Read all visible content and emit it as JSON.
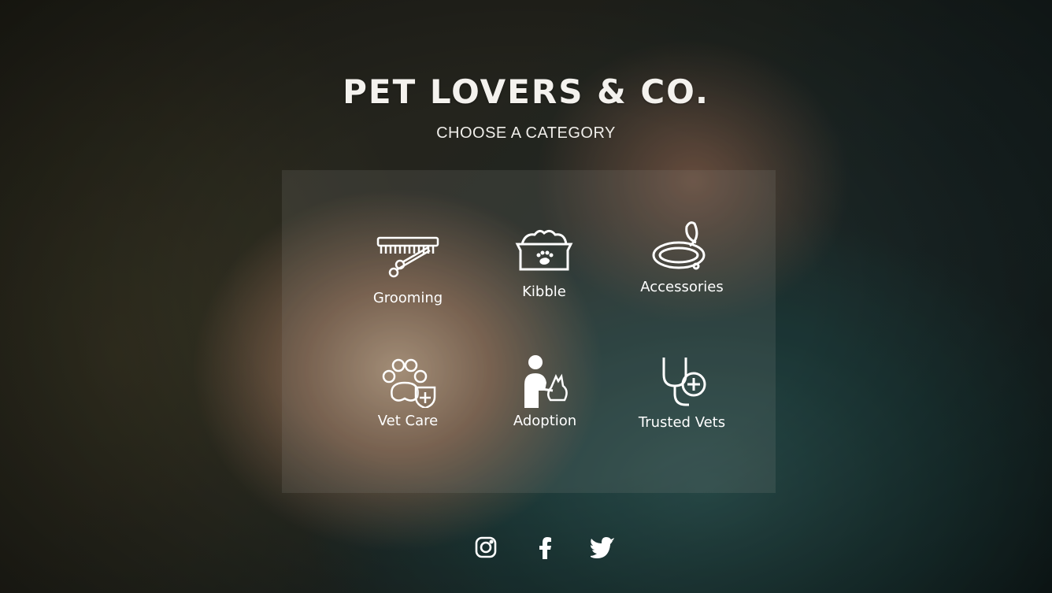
{
  "brand": {
    "title": "PET LOVERS & CO."
  },
  "header": {
    "subtitle": "CHOOSE A CATEGORY"
  },
  "categories": [
    {
      "label": "Grooming",
      "icon": "comb-scissors-icon"
    },
    {
      "label": "Kibble",
      "icon": "food-bowl-icon"
    },
    {
      "label": "Accessories",
      "icon": "collar-icon"
    },
    {
      "label": "Vet Care",
      "icon": "pet-health-icon"
    },
    {
      "label": "Adoption",
      "icon": "person-with-dog-icon"
    },
    {
      "label": "Trusted Vets",
      "icon": "stethoscope-icon"
    }
  ],
  "social": [
    {
      "name": "instagram-icon"
    },
    {
      "name": "facebook-icon"
    },
    {
      "name": "twitter-icon"
    }
  ],
  "colors": {
    "text": "#ffffff",
    "panel": "rgba(150,150,140,0.16)"
  }
}
